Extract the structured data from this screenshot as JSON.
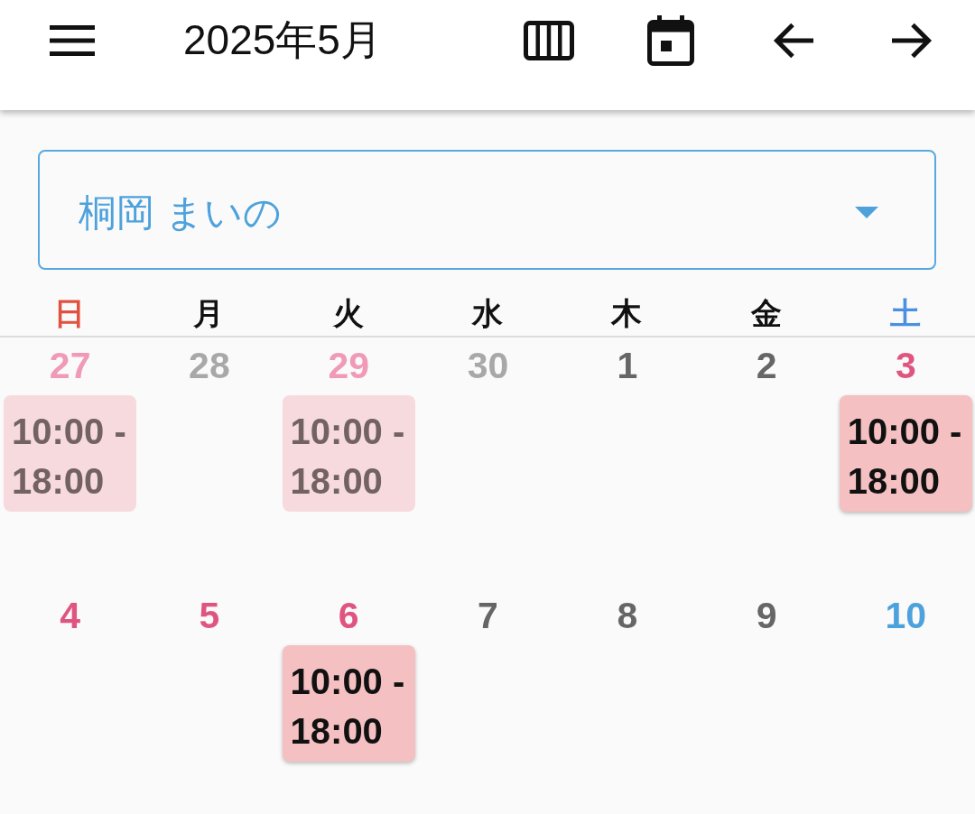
{
  "app_bar": {
    "title": "2025年5月"
  },
  "staff_select": {
    "value": "桐岡 まいの"
  },
  "weekdays": [
    {
      "label": "日",
      "kind": "sunday"
    },
    {
      "label": "月",
      "kind": "weekday"
    },
    {
      "label": "火",
      "kind": "weekday"
    },
    {
      "label": "水",
      "kind": "weekday"
    },
    {
      "label": "木",
      "kind": "weekday"
    },
    {
      "label": "金",
      "kind": "weekday"
    },
    {
      "label": "土",
      "kind": "saturday"
    }
  ],
  "weeks": [
    {
      "days": [
        {
          "date": "27",
          "kind": "holiday",
          "in_month": false,
          "shifts": [
            {
              "time": "10:00 - 18:00"
            }
          ]
        },
        {
          "date": "28",
          "kind": "weekday",
          "in_month": false
        },
        {
          "date": "29",
          "kind": "holiday",
          "in_month": false,
          "shifts": [
            {
              "time": "10:00 - 18:00"
            }
          ]
        },
        {
          "date": "30",
          "kind": "weekday",
          "in_month": false
        },
        {
          "date": "1",
          "kind": "weekday",
          "in_month": true
        },
        {
          "date": "2",
          "kind": "weekday",
          "in_month": true
        },
        {
          "date": "3",
          "kind": "holiday",
          "in_month": true,
          "shifts": [
            {
              "time": "10:00 - 18:00"
            }
          ]
        }
      ]
    },
    {
      "days": [
        {
          "date": "4",
          "kind": "holiday",
          "in_month": true
        },
        {
          "date": "5",
          "kind": "holiday",
          "in_month": true
        },
        {
          "date": "6",
          "kind": "holiday",
          "in_month": true,
          "shifts": [
            {
              "time": "10:00 - 18:00"
            }
          ]
        },
        {
          "date": "7",
          "kind": "weekday",
          "in_month": true
        },
        {
          "date": "8",
          "kind": "weekday",
          "in_month": true
        },
        {
          "date": "9",
          "kind": "weekday",
          "in_month": true
        },
        {
          "date": "10",
          "kind": "saturday",
          "in_month": true
        }
      ]
    }
  ]
}
